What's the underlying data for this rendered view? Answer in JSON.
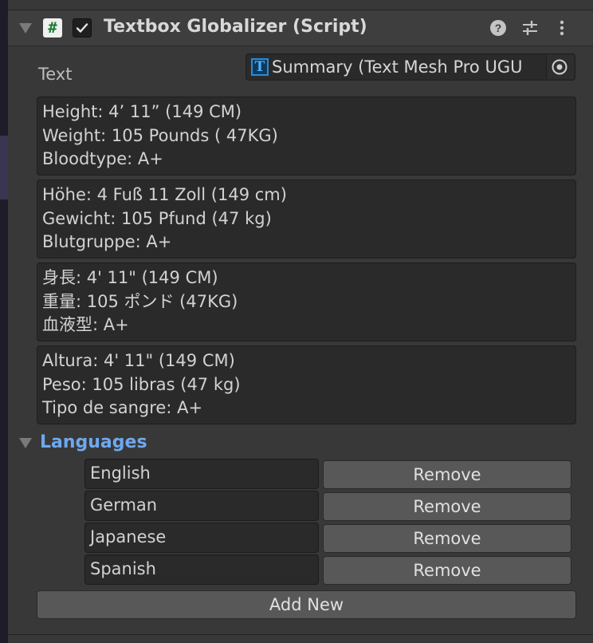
{
  "component": {
    "title": "Textbox Globalizer (Script)",
    "enabled": true,
    "icons": [
      "fold-arrow-icon",
      "script-icon",
      "checkbox-icon",
      "help-icon",
      "settings-icon",
      "more-icon"
    ]
  },
  "text_field": {
    "label": "Text",
    "value": "Summary (Text Mesh Pro UGU",
    "icon": "text-mesh-pro-icon"
  },
  "text_blocks": [
    {
      "lines": [
        "Height:  4’ 11” (149 CM)",
        "Weight:  105 Pounds ( 47KG)",
        "Bloodtype: A+"
      ]
    },
    {
      "lines": [
        "Höhe: 4 Fuß 11 Zoll (149 cm)",
        "Gewicht: 105 Pfund (47 kg)",
        "Blutgruppe: A+"
      ]
    },
    {
      "lines": [
        "身長: 4' 11\" (149 CM)",
        "重量: 105 ポンド (47KG)",
        "血液型: A+"
      ]
    },
    {
      "lines": [
        "Altura: 4' 11\" (149 CM)",
        "Peso: 105 libras (47 kg)",
        "Tipo de sangre: A+"
      ]
    }
  ],
  "languages": {
    "label": "Languages",
    "items": [
      {
        "name": "English",
        "remove_label": "Remove"
      },
      {
        "name": "German",
        "remove_label": "Remove"
      },
      {
        "name": "Japanese",
        "remove_label": "Remove"
      },
      {
        "name": "Spanish",
        "remove_label": "Remove"
      }
    ],
    "add_label": "Add New"
  },
  "colors": {
    "panel_bg": "#383838",
    "field_bg": "#2a2a2a",
    "button_bg": "#585858",
    "accent_blue": "#6fa8f0",
    "script_green": "#1c7a2e"
  }
}
